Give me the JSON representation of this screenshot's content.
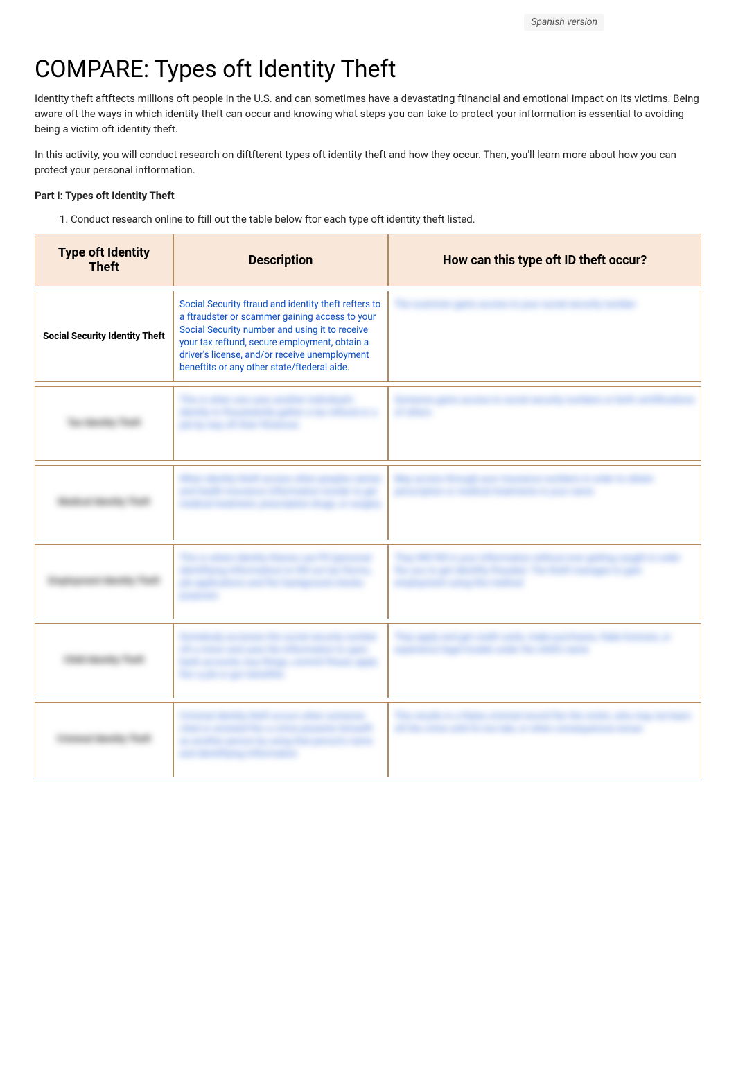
{
  "header": {
    "spanish_link": "Spanish version",
    "title": "COMPARE: Types oft Identity Theft"
  },
  "intro": {
    "p1": "Identity theft aftftects millions oft people in the U.S. and can sometimes have a devastating ftinancial and emotional impact on its victims. Being aware oft the ways in which identity theft can occur and knowing what steps you can take to protect your inftormation is essential to avoiding being a victim oft identity theft.",
    "p2": "In this activity, you will conduct research on diftfterent types oft identity theft and how they occur. Then, you'll learn more about how you can protect your personal inftormation."
  },
  "part_label": "Part I: Types oft Identity Theft",
  "instruction": "Conduct research online to ftill out the table below ftor each type oft identity theft listed.",
  "table": {
    "headers": {
      "type": "Type oft Identity Theft",
      "description": "Description",
      "how": "How can this type oft ID theft occur?"
    },
    "rows": [
      {
        "type": "Social Security Identity Theft",
        "description": "Social Security ftraud and identity theft refters to a ftraudster or scammer gaining access to your Social Security number and using it to receive your tax reftund, secure employment, obtain a driver's license, and/or receive unemployment beneftits or any other state/ftederal aide.",
        "how": "The scammer gains access to your social security number",
        "blur_type": false,
        "blur_how": true
      },
      {
        "type": "Tax Identity Theft",
        "description": "This is when one uses another individual's identity to ftraudulently gather a tax reftund or a job by way oft their ftinances",
        "how": "Someone gains access to social security numbers or birth certiftications of others",
        "blur_type": true,
        "blur_how": true
      },
      {
        "type": "Medical Identity Theft",
        "description": "When identity thieft access other peoples names and health insurance inftormation inorder to get medical treatment, prescription drugs, or surgery",
        "how": "May access through your insurance numbers in order to obtain perscription or medical treatments in your name",
        "blur_type": true,
        "blur_how": true
      },
      {
        "type": "Employment Identity Theft",
        "description": "This is where identity thieves use PII (personal identiftying inftormation) to ftill out tax ftorms, job applications and ftor background checks purposes",
        "how": "They Will ftill in your inftormation without ever getting caught in order ftor you to get identifty ftrauded. The thieft manages to gain employment using this method",
        "blur_type": true,
        "blur_how": true
      },
      {
        "type": "Child Identity Theft",
        "description": "Somebody accesses the social security number oft a minor and uses the inftormation to open bank accounts, buy things, commit ftraud, apply ftor a job or gov beneftits",
        "how": "They apply and get credit cards, make purchases, ftake licenses, or experience legal trouble under the child's name",
        "blur_type": true,
        "blur_how": true
      },
      {
        "type": "Criminal Identity Theft",
        "description": "Criminal identity theft occurs when someone cited or arrested ftor a crime presents himselft as another person by using that person's name and identiftying inftormation",
        "how": "This results in a ftalse criminal record ftor the victim, who may not learn oft the crime until it's too late, or when consequences ensue",
        "blur_type": true,
        "blur_how": true
      }
    ]
  }
}
